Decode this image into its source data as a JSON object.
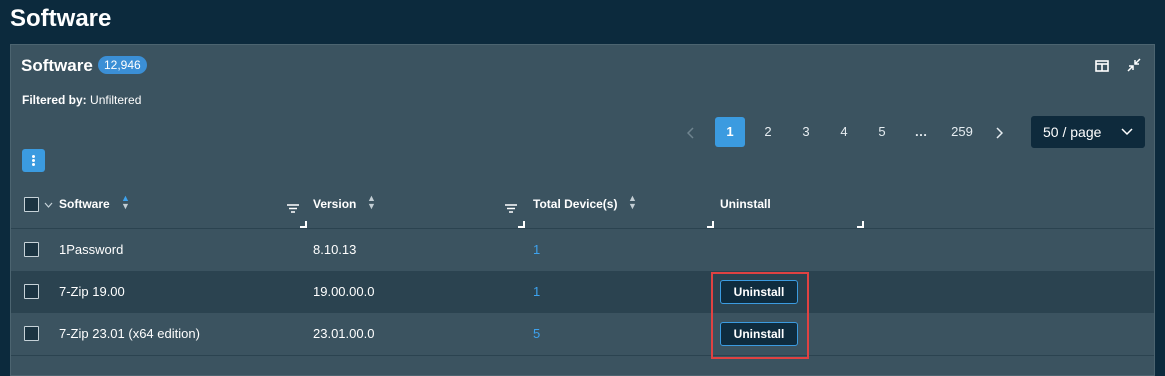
{
  "page": {
    "title": "Software"
  },
  "panel": {
    "title": "Software",
    "count": "12,946",
    "filtered_label": "Filtered by:",
    "filtered_value": "Unfiltered"
  },
  "pagination": {
    "pages": [
      "1",
      "2",
      "3",
      "4",
      "5",
      "…",
      "259"
    ],
    "active": "1",
    "page_size": "50 / page"
  },
  "table": {
    "columns": {
      "software": "Software",
      "version": "Version",
      "devices": "Total Device(s)",
      "uninstall": "Uninstall"
    },
    "rows": [
      {
        "name": "1Password",
        "version": "8.10.13",
        "devices": "1",
        "uninstall": ""
      },
      {
        "name": "7-Zip 19.00",
        "version": "19.00.00.0",
        "devices": "1",
        "uninstall": "Uninstall"
      },
      {
        "name": "7-Zip 23.01 (x64 edition)",
        "version": "23.01.00.0",
        "devices": "5",
        "uninstall": "Uninstall"
      }
    ]
  },
  "colors": {
    "background": "#0c2a3d",
    "panel": "#3b5360",
    "accent": "#3b9be0",
    "highlight": "#e04242"
  },
  "icons": [
    "columns-icon",
    "collapse-icon",
    "kebab-menu-icon",
    "filter-icon",
    "sort-icon",
    "chevron-left-icon",
    "chevron-right-icon",
    "chevron-down-icon"
  ]
}
